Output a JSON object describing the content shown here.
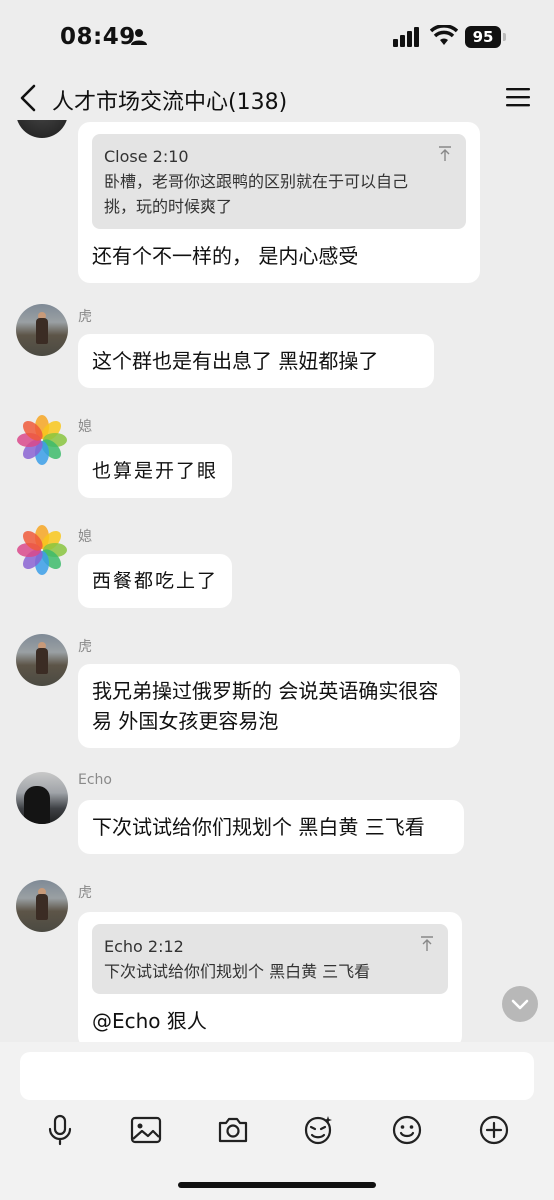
{
  "status_bar": {
    "time": "08:49",
    "battery": "95"
  },
  "nav": {
    "title": "人才市场交流中心(138)"
  },
  "messages": [
    {
      "sender": "",
      "quote": {
        "author": "Close 2:10",
        "text": "卧槽，老哥你这跟鸭的区别就在于可以自己挑，玩的时候爽了"
      },
      "text": "还有个不一样的， 是内心感受"
    },
    {
      "sender": "虎",
      "text": "这个群也是有出息了  黑妞都操了"
    },
    {
      "sender": "媳",
      "text": "也算是开了眼"
    },
    {
      "sender": "媳",
      "text": "西餐都吃上了"
    },
    {
      "sender": "虎",
      "text": "我兄弟操过俄罗斯的 会说英语确实很容易  外国女孩更容易泡"
    },
    {
      "sender": "Echo",
      "text": "下次试试给你们规划个  黑白黄 三飞看"
    },
    {
      "sender": "虎",
      "quote": {
        "author": "Echo 2:12",
        "text": "下次试试给你们规划个   黑白黄 三飞看"
      },
      "text": "@Echo 狠人"
    }
  ],
  "icons": {
    "voice": "microphone-icon",
    "image": "image-icon",
    "camera": "camera-icon",
    "sticker": "sticker-icon",
    "emoji": "emoji-icon",
    "more": "plus-icon"
  },
  "colors": {
    "background": "#ededed",
    "bubble": "#ffffff",
    "quote": "#e4e4e4"
  }
}
